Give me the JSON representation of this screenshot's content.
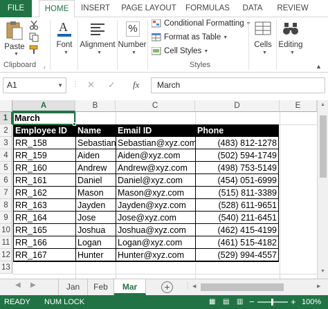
{
  "ribbon_tabs": [
    "FILE",
    "HOME",
    "INSERT",
    "PAGE LAYOUT",
    "FORMULAS",
    "DATA",
    "REVIEW"
  ],
  "ribbon": {
    "paste_label": "Paste",
    "clipboard_group": "Clipboard",
    "font_label": "Font",
    "alignment_label": "Alignment",
    "number_label": "Number",
    "percent_symbol": "%",
    "conditional_formatting": "Conditional Formatting",
    "format_as_table": "Format as Table",
    "cell_styles": "Cell Styles",
    "styles_group": "Styles",
    "cells_label": "Cells",
    "editing_label": "Editing"
  },
  "formula_bar": {
    "name_box": "A1",
    "fx_label": "fx",
    "cancel_symbol": "✕",
    "enter_symbol": "✓",
    "content": "March"
  },
  "grid": {
    "columns": [
      "A",
      "B",
      "C",
      "D",
      "E"
    ],
    "rows": [
      "1",
      "2",
      "3",
      "4",
      "5",
      "6",
      "7",
      "8",
      "9",
      "10",
      "11",
      "12",
      "13"
    ],
    "title_cell": "March",
    "headers": [
      "Employee ID",
      "Name",
      "Email ID",
      "Phone"
    ],
    "data": [
      [
        "RR_158",
        "Sebastian",
        "Sebastian@xyz.com",
        "(483)  812-1278"
      ],
      [
        "RR_159",
        "Aiden",
        "Aiden@xyz.com",
        "(502)  594-1749"
      ],
      [
        "RR_160",
        "Andrew",
        "Andrew@xyz.com",
        "(498)  753-5149"
      ],
      [
        "RR_161",
        "Daniel",
        "Daniel@xyz.com",
        "(454)  051-6999"
      ],
      [
        "RR_162",
        "Mason",
        "Mason@xyz.com",
        "(515)  811-3389"
      ],
      [
        "RR_163",
        "Jayden",
        "Jayden@xyz.com",
        "(528)  611-9651"
      ],
      [
        "RR_164",
        "Jose",
        "Jose@xyz.com",
        "(540)  211-6451"
      ],
      [
        "RR_165",
        "Joshua",
        "Joshua@xyz.com",
        "(462)  415-4199"
      ],
      [
        "RR_166",
        "Logan",
        "Logan@xyz.com",
        "(461)  515-4182"
      ],
      [
        "RR_167",
        "Hunter",
        "Hunter@xyz.com",
        "(529)  994-4557"
      ]
    ]
  },
  "sheets": {
    "tabs": [
      "Jan",
      "Feb",
      "Mar"
    ],
    "active": "Mar",
    "add_symbol": "+"
  },
  "status": {
    "ready": "READY",
    "num_lock": "NUM LOCK",
    "zoom": "100%",
    "zoom_minus": "−",
    "zoom_plus": "+"
  },
  "colors": {
    "accent": "#217346",
    "table_header_bg": "#000000"
  }
}
